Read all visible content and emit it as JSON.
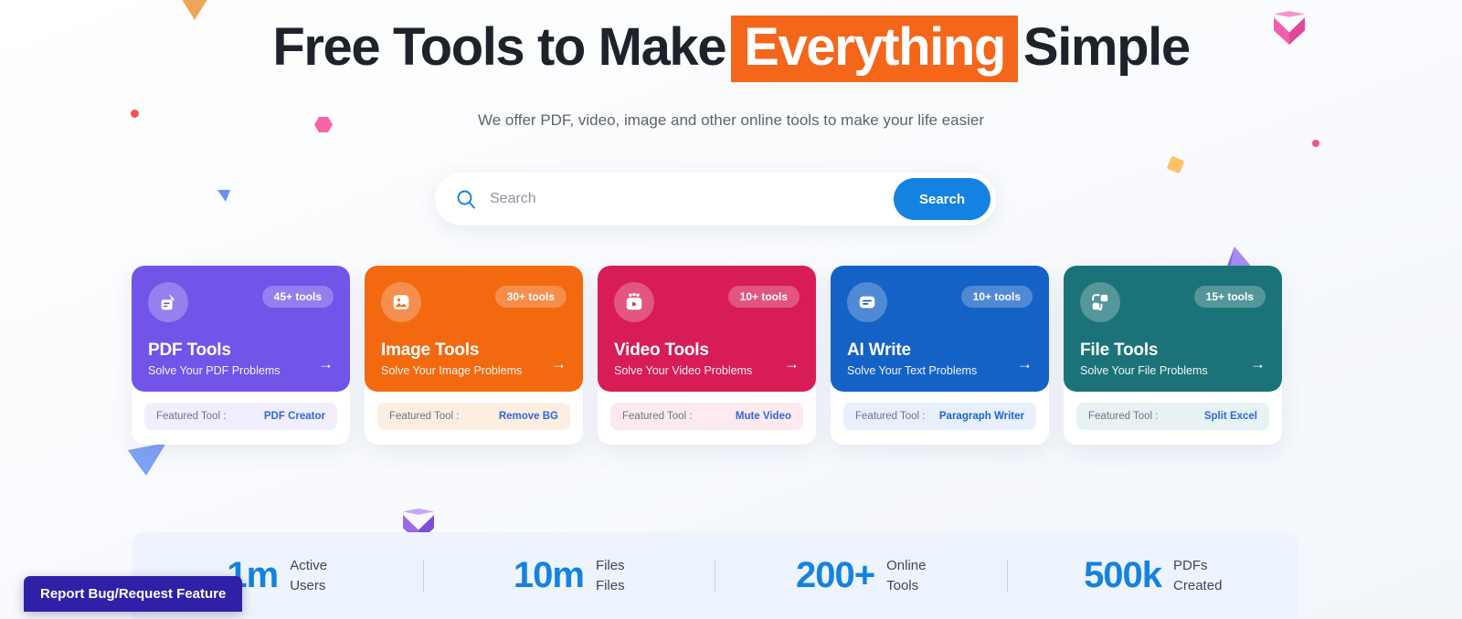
{
  "hero": {
    "title_before": "Free Tools to Make",
    "title_highlight": "Everything",
    "title_after": "Simple",
    "subtitle": "We offer PDF, video, image and other online tools to make your life easier"
  },
  "search": {
    "placeholder": "Search",
    "value": "",
    "button_label": "Search",
    "icon": "search-icon",
    "accent": "#1482e0"
  },
  "cards": [
    {
      "title": "PDF Tools",
      "desc": "Solve Your PDF Problems",
      "badge": "45+ tools",
      "featured_label": "Featured Tool :",
      "featured_tool": "PDF Creator",
      "icon": "document-icon",
      "color": "#7254e8",
      "foot_bg": "#f1eefe",
      "foot_color": "#2f68d8",
      "arrow": "→"
    },
    {
      "title": "Image Tools",
      "desc": "Solve Your Image Problems",
      "badge": "30+ tools",
      "featured_label": "Featured Tool :",
      "featured_tool": "Remove BG",
      "icon": "image-icon",
      "color": "#f2690f",
      "foot_bg": "#fdeee2",
      "foot_color": "#2f68d8",
      "arrow": "→"
    },
    {
      "title": "Video Tools",
      "desc": "Solve Your Video Problems",
      "badge": "10+ tools",
      "featured_label": "Featured Tool :",
      "featured_tool": "Mute Video",
      "icon": "video-icon",
      "color": "#d81c55",
      "foot_bg": "#fdeaee",
      "foot_color": "#2f68d8",
      "arrow": "→"
    },
    {
      "title": "AI Write",
      "desc": "Solve Your Text Problems",
      "badge": "10+ tools",
      "featured_label": "Featured Tool :",
      "featured_tool": "Paragraph Writer",
      "icon": "text-box-icon",
      "color": "#1562c6",
      "foot_bg": "#e8f0fc",
      "foot_color": "#1b63cf",
      "arrow": "→"
    },
    {
      "title": "File Tools",
      "desc": "Solve Your File Problems",
      "badge": "15+ tools",
      "featured_label": "Featured Tool :",
      "featured_tool": "Split Excel",
      "icon": "file-convert-icon",
      "color": "#1b7379",
      "foot_bg": "#e7f2f4",
      "foot_color": "#2f68d8",
      "arrow": "→"
    }
  ],
  "stats": [
    {
      "number": "1m",
      "label_line1": "Active",
      "label_line2": "Users"
    },
    {
      "number": "10m",
      "label_line1": "Files",
      "label_line2": "Files"
    },
    {
      "number": "200+",
      "label_line1": "Online",
      "label_line2": "Tools"
    },
    {
      "number": "500k",
      "label_line1": "PDFs",
      "label_line2": "Created"
    }
  ],
  "report_badge": {
    "label": "Report Bug/Request Feature",
    "color": "#2e21a8"
  }
}
